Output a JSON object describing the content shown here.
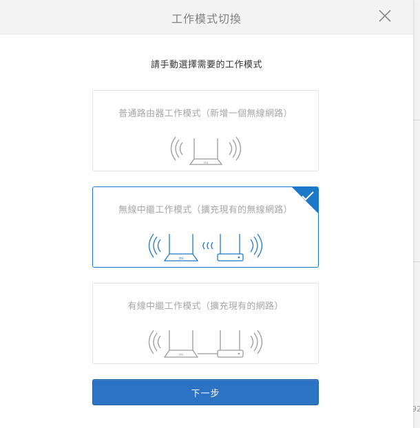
{
  "dialog": {
    "title": "工作模式切換",
    "instruction": "請手動選擇需要的工作模式",
    "next_label": "下一步"
  },
  "modes": [
    {
      "label": "普通路由器工作模式（新增一個無線網路）",
      "selected": false,
      "icon": "single-router-wireless-icon"
    },
    {
      "label": "無線中繼工作模式（擴充現有的無線網路）",
      "selected": true,
      "icon": "wireless-repeater-icon"
    },
    {
      "label": "有線中繼工作模式（擴充現有的網路）",
      "selected": false,
      "icon": "wired-repeater-icon"
    }
  ],
  "background": {
    "partial_text": "92"
  },
  "colors": {
    "accent": "#2c73c4",
    "selected_border": "#1c78c8",
    "icon_inactive": "#9a9a9a"
  }
}
